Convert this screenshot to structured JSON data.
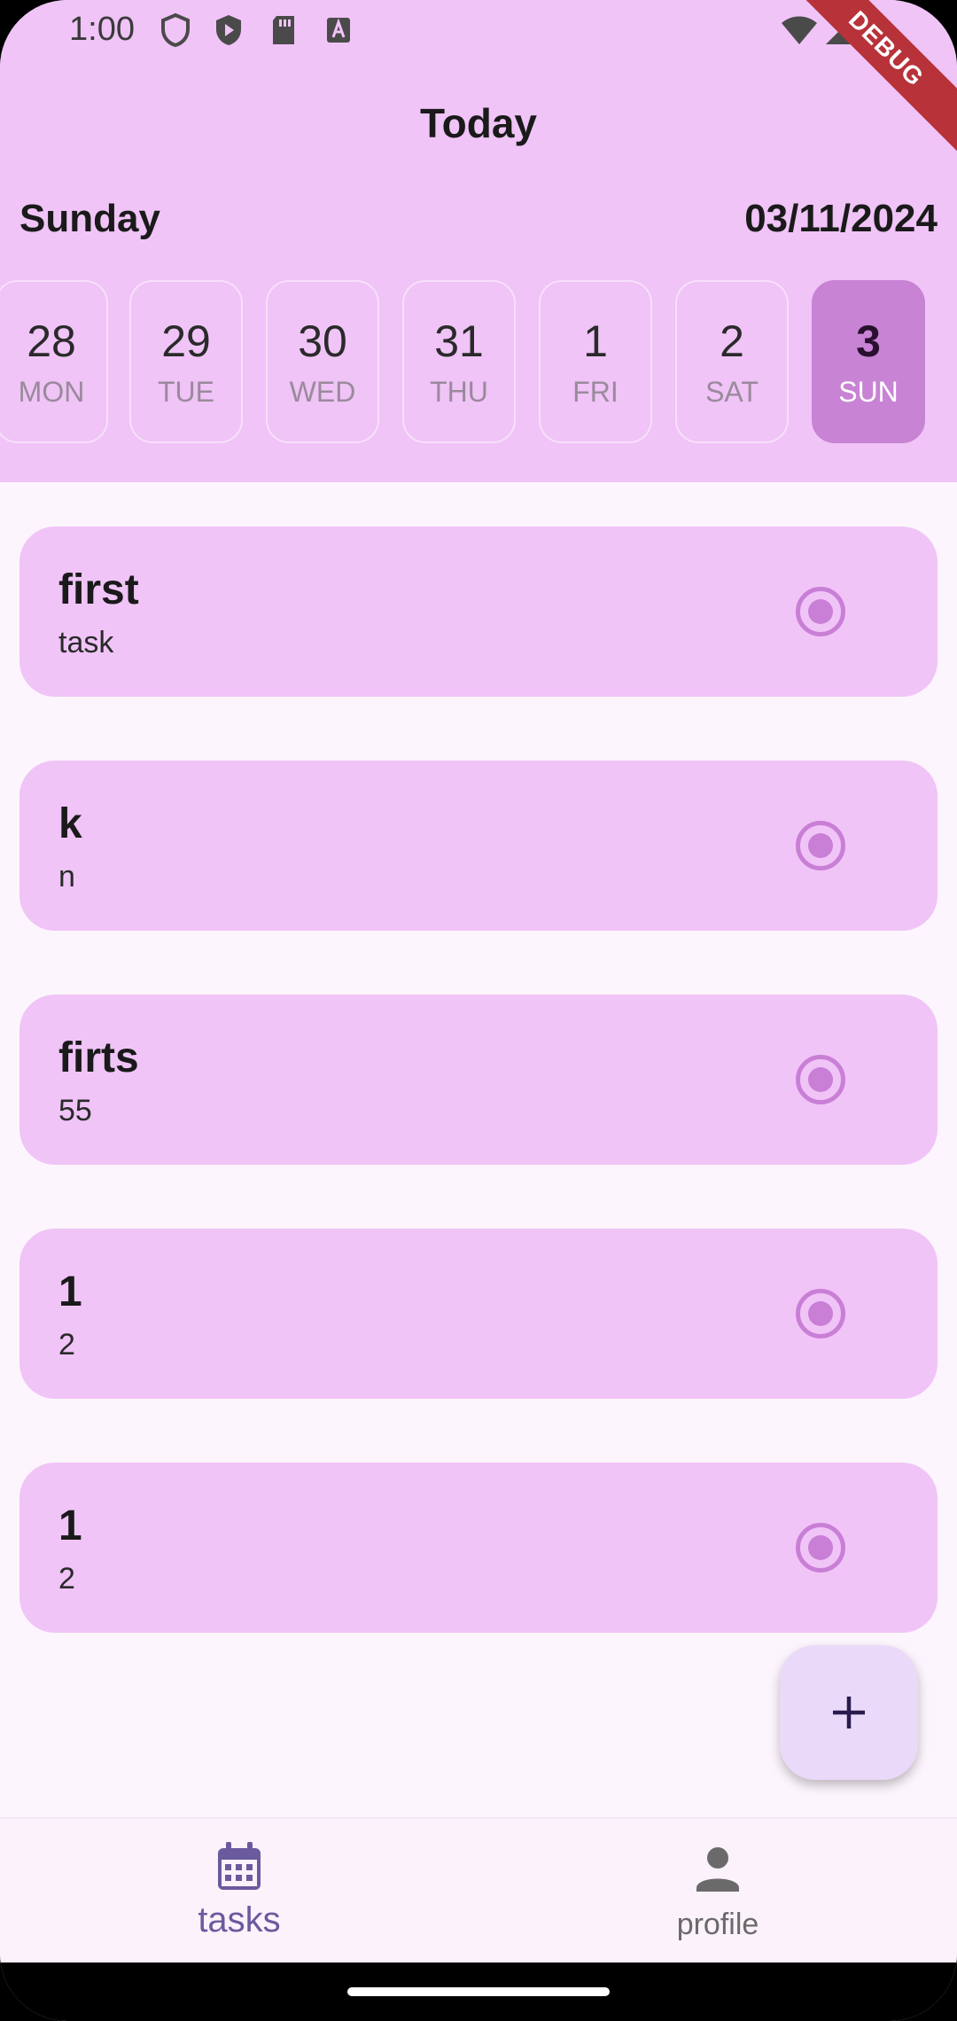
{
  "status_bar": {
    "time": "1:00",
    "debug_label": "DEBUG"
  },
  "header": {
    "title": "Today",
    "day_name": "Sunday",
    "date": "03/11/2024"
  },
  "day_strip": [
    {
      "num": "28",
      "weekday": "MON",
      "selected": false
    },
    {
      "num": "29",
      "weekday": "TUE",
      "selected": false
    },
    {
      "num": "30",
      "weekday": "WED",
      "selected": false
    },
    {
      "num": "31",
      "weekday": "THU",
      "selected": false
    },
    {
      "num": "1",
      "weekday": "FRI",
      "selected": false
    },
    {
      "num": "2",
      "weekday": "SAT",
      "selected": false
    },
    {
      "num": "3",
      "weekday": "SUN",
      "selected": true
    }
  ],
  "tasks": [
    {
      "title": "first",
      "subtitle": "task"
    },
    {
      "title": "k",
      "subtitle": "n"
    },
    {
      "title": "firts",
      "subtitle": "55"
    },
    {
      "title": "1",
      "subtitle": "2"
    },
    {
      "title": "1",
      "subtitle": "2"
    }
  ],
  "fab": {
    "icon": "plus-icon"
  },
  "bottom_nav": {
    "tasks_label": "tasks",
    "profile_label": "profile"
  },
  "colors": {
    "header_bg": "#f0c4f7",
    "card_bg": "#f0c4f7",
    "selected_day": "#c883d4",
    "radio": "#c97fd6",
    "nav_active": "#6a5a9e",
    "nav_inactive": "#6a6a6a",
    "fab_bg": "#ead9f8"
  }
}
